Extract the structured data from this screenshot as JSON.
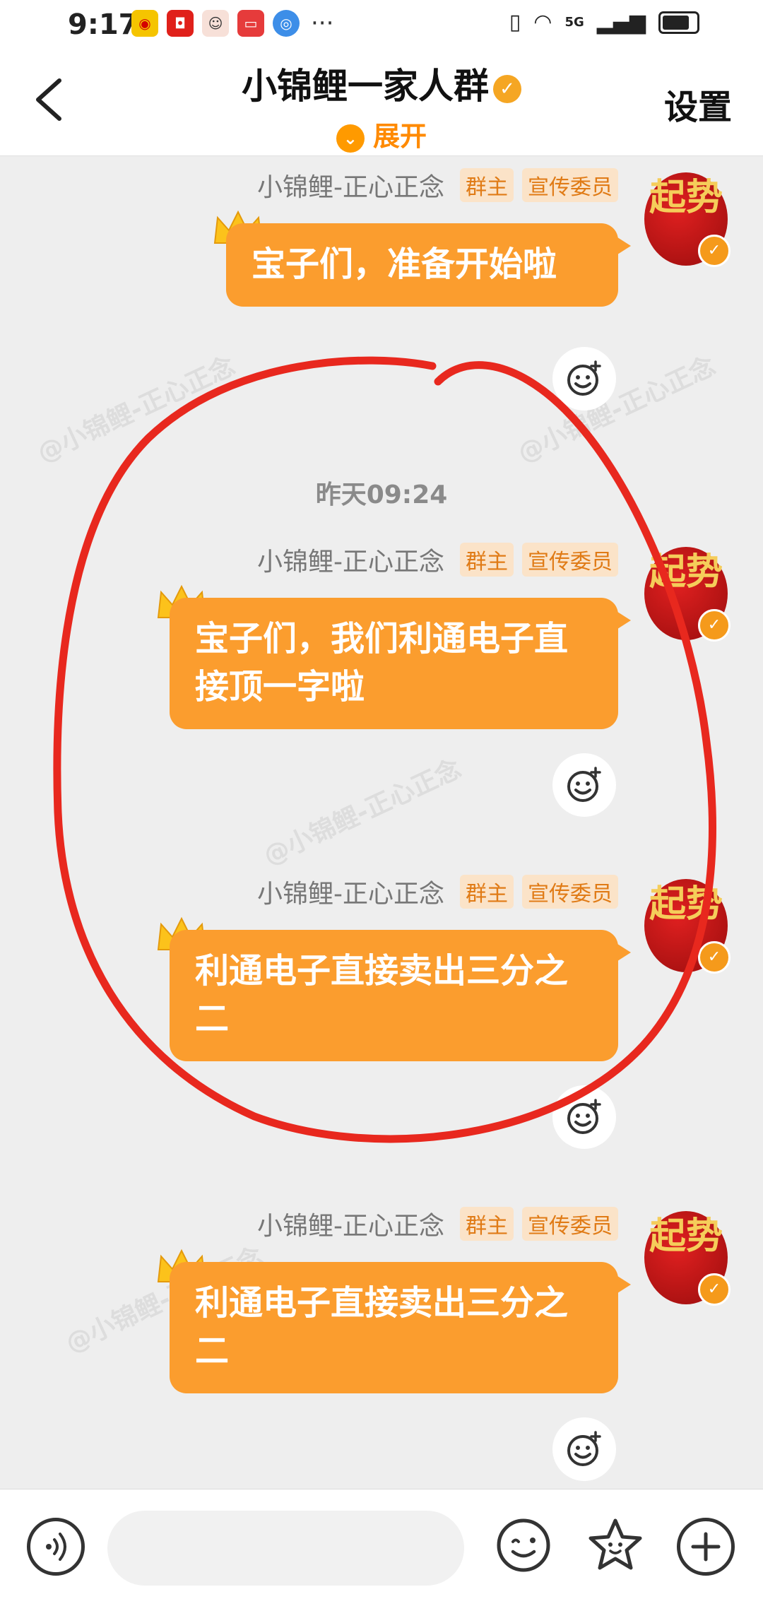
{
  "status_bar": {
    "time": "9:17",
    "app_icons": [
      "weibo-icon",
      "app-red-icon",
      "avatar-app-icon",
      "app-pink-icon",
      "browser-icon"
    ],
    "more": "···",
    "network": "5G"
  },
  "header": {
    "title": "小锦鲤一家人群",
    "expand_label": "展开",
    "settings_label": "设置"
  },
  "messages": [
    {
      "sender": "小锦鲤-正心正念",
      "tags": [
        "群主",
        "宣传委员"
      ],
      "avatar_text": "起势",
      "text": "宝子们，准备开始啦"
    },
    {
      "sender": "小锦鲤-正心正念",
      "tags": [
        "群主",
        "宣传委员"
      ],
      "avatar_text": "起势",
      "text": "宝子们，我们利通电子直接顶一字啦"
    },
    {
      "sender": "小锦鲤-正心正念",
      "tags": [
        "群主",
        "宣传委员"
      ],
      "avatar_text": "起势",
      "text": "利通电子直接卖出三分之二"
    },
    {
      "sender": "小锦鲤-正心正念",
      "tags": [
        "群主",
        "宣传委员"
      ],
      "avatar_text": "起势",
      "text": "利通电子直接卖出三分之二"
    }
  ],
  "time_divider": "昨天09:24",
  "watermark": "@小锦鲤-正心正念",
  "input_bar": {
    "placeholder": ""
  },
  "colors": {
    "bubble": "#fb9d2e",
    "accent": "#ff8a00",
    "annotation": "#e8281e"
  }
}
